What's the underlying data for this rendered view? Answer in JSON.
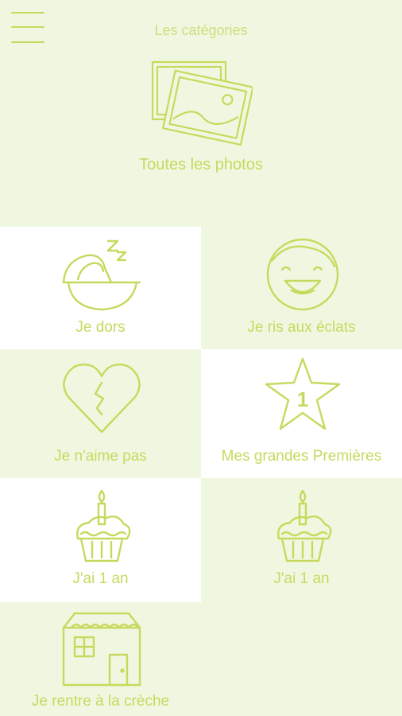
{
  "header": {
    "title": "Les catégories",
    "menu_icon": "hamburger-menu-icon"
  },
  "all_photos": {
    "label": "Toutes les photos",
    "icon": "photos-stack-icon"
  },
  "categories": [
    {
      "label": "Je dors",
      "icon": "sleeping-cradle-icon"
    },
    {
      "label": "Je ris aux éclats",
      "icon": "laughing-face-icon"
    },
    {
      "label": "Je n'aime pas",
      "icon": "broken-heart-icon"
    },
    {
      "label": "Mes grandes Premières",
      "icon": "star-number-one-icon",
      "badge": "1"
    },
    {
      "label": "J'ai 1 an",
      "icon": "birthday-cupcake-icon"
    },
    {
      "label": "J'ai 1 an",
      "icon": "birthday-cupcake-icon"
    },
    {
      "label": "Je rentre à la crèche",
      "icon": "house-icon"
    }
  ],
  "colors": {
    "accent": "#c7d95d",
    "background": "#f0f7e1",
    "tile_white": "#ffffff"
  }
}
